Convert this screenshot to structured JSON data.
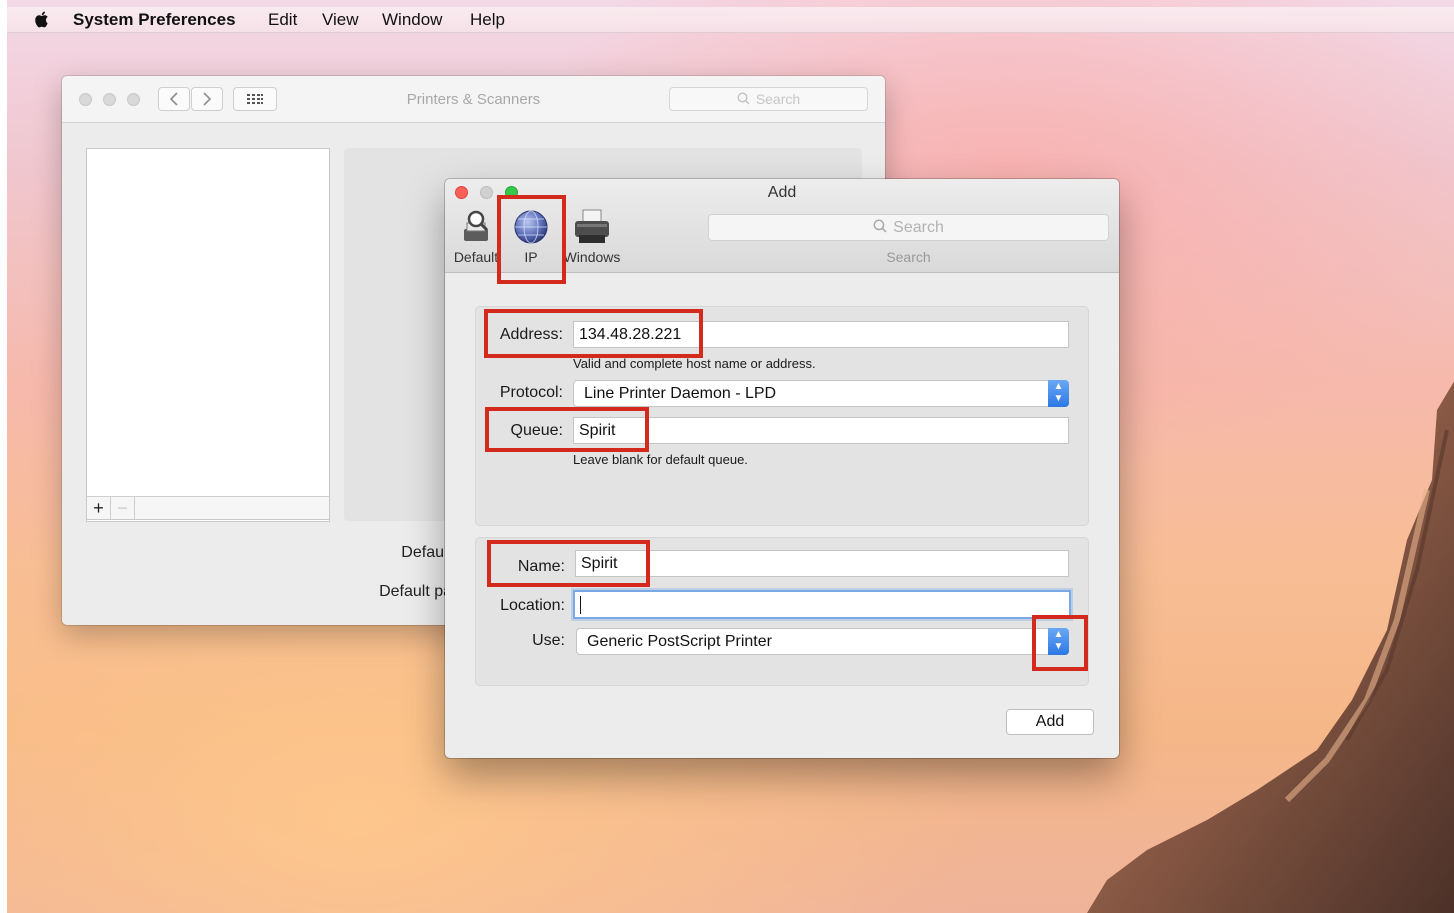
{
  "menubar": {
    "app_name": "System Preferences",
    "items": [
      "Edit",
      "View",
      "Window",
      "Help"
    ]
  },
  "back_window": {
    "title": "Printers & Scanners",
    "search_placeholder": "Search",
    "add_button": "+",
    "remove_button": "−",
    "labels": [
      "Default",
      "Default pa"
    ]
  },
  "dialog": {
    "title": "Add",
    "toolbar": {
      "tabs": [
        {
          "label": "Default",
          "icon": "default-printer-icon"
        },
        {
          "label": "IP",
          "icon": "ip-globe-icon"
        },
        {
          "label": "Windows",
          "icon": "windows-printer-icon"
        }
      ],
      "search_placeholder": "Search",
      "search_caption": "Search"
    },
    "address": {
      "label": "Address:",
      "value": "134.48.28.221",
      "hint": "Valid and complete host name or address."
    },
    "protocol": {
      "label": "Protocol:",
      "value": "Line Printer Daemon - LPD"
    },
    "queue": {
      "label": "Queue:",
      "value": "Spirit",
      "hint": "Leave blank for default queue."
    },
    "name": {
      "label": "Name:",
      "value": "Spirit"
    },
    "location": {
      "label": "Location:",
      "value": ""
    },
    "use": {
      "label": "Use:",
      "value": "Generic PostScript Printer"
    },
    "add_button": "Add"
  },
  "colors": {
    "annotation": "#d42a1e",
    "accent_blue": "#2b78e4",
    "close": "#fc5f57",
    "minimize": "#d0d0d0",
    "zoom": "#35c84a"
  }
}
